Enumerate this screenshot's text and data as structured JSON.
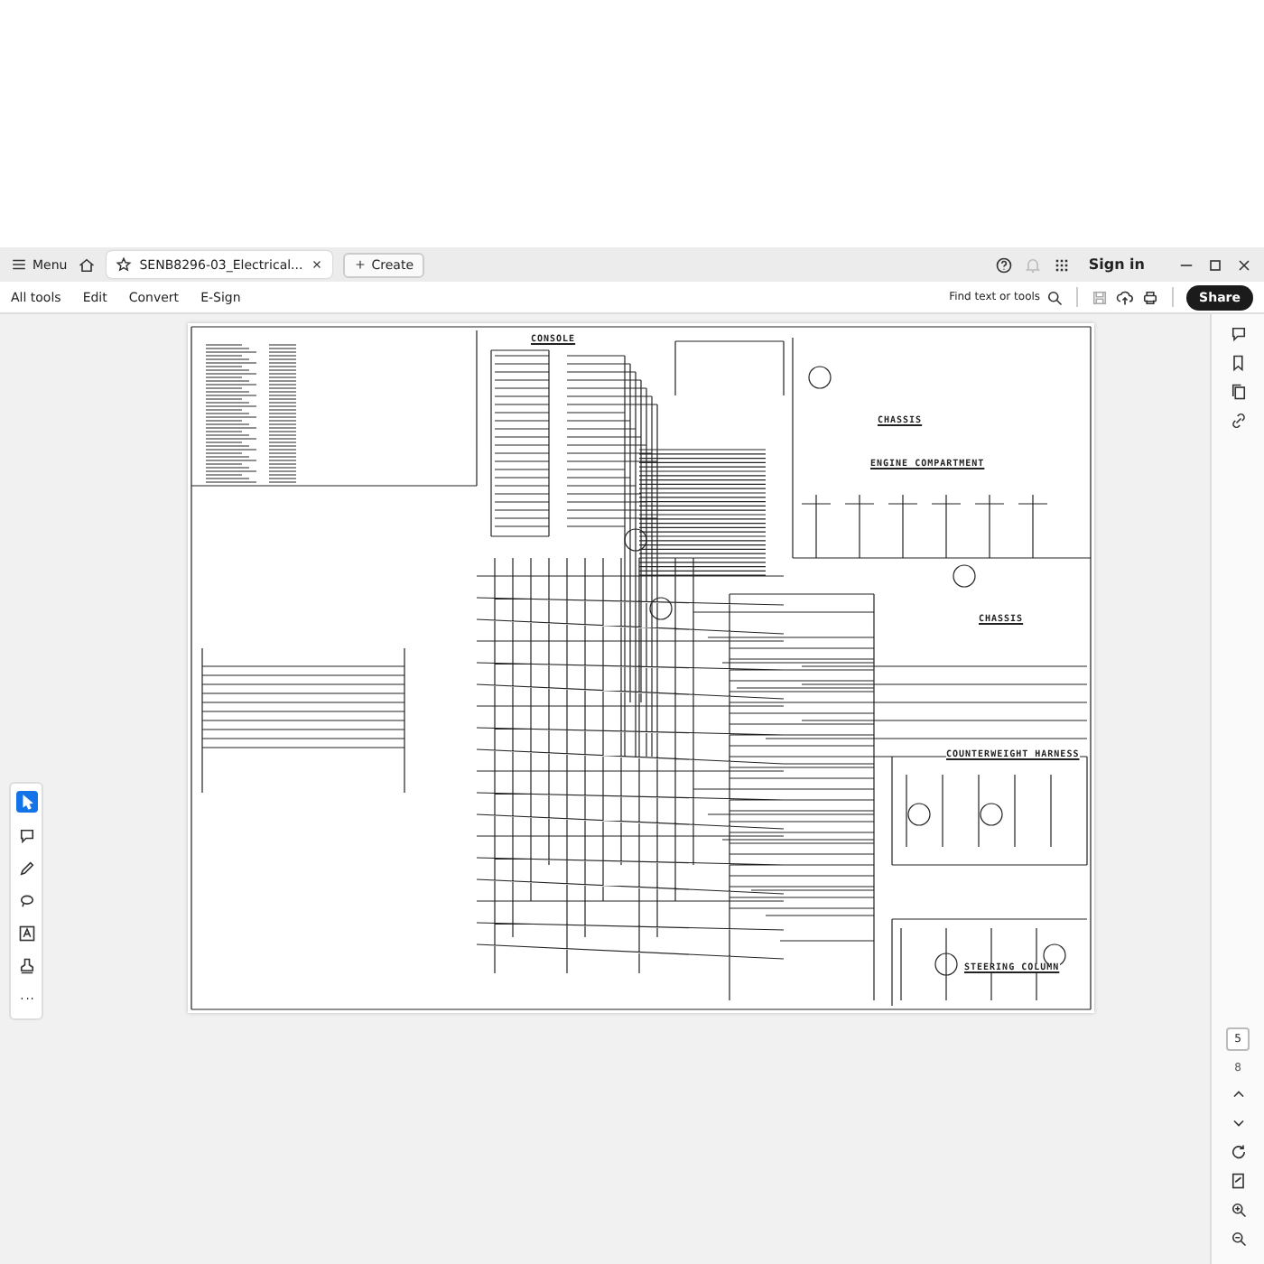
{
  "tab_bar": {
    "menu_label": "Menu",
    "tabs": [
      {
        "label": "SENB8296-03_Electrical...",
        "selected": true
      }
    ],
    "create_label": "Create",
    "sign_in": "Sign in"
  },
  "toolbar": {
    "items": [
      "All tools",
      "Edit",
      "Convert",
      "E-Sign"
    ],
    "search_label": "Find text or tools",
    "share_label": "Share"
  },
  "page_indicator": {
    "current": "5",
    "total": "8"
  },
  "document": {
    "headings": [
      "CONSOLE",
      "CHASSIS",
      "ENGINE COMPARTMENT",
      "CHASSIS",
      "COUNTERWEIGHT HARNESS",
      "STEERING COLUMN"
    ]
  }
}
